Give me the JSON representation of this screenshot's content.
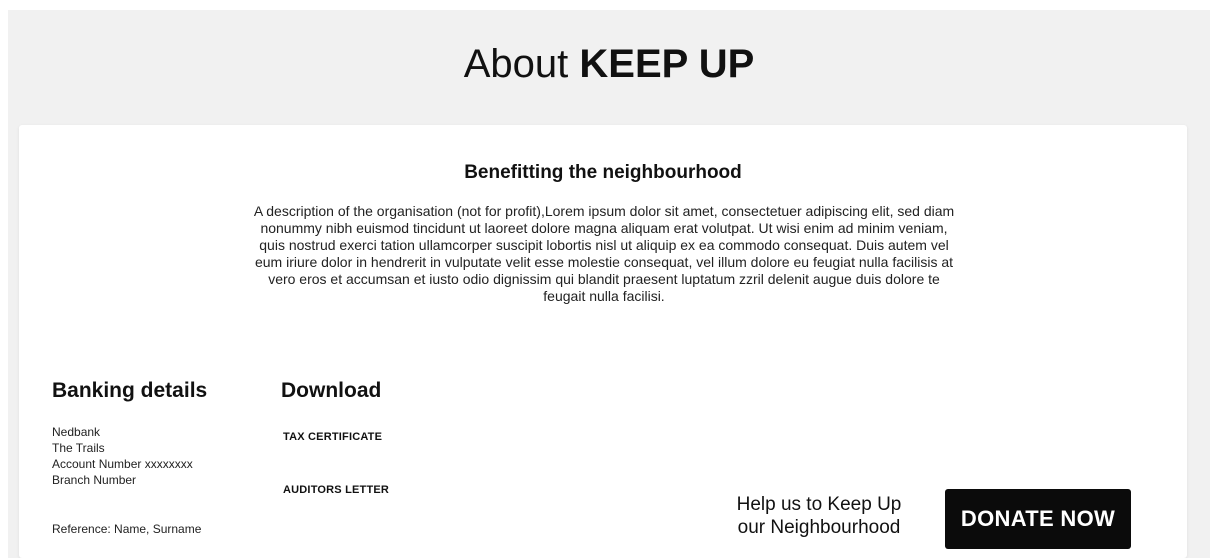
{
  "header": {
    "title_prefix": "About ",
    "title_brand": "KEEP UP"
  },
  "intro": {
    "heading": "Benefitting the neighbourhood",
    "description": "A description of the organisation (not for profit),Lorem ipsum dolor sit amet, consectetuer adipiscing elit, sed diam nonummy nibh euismod tincidunt ut laoreet dolore magna aliquam erat volutpat. Ut wisi enim ad minim veniam, quis nostrud exerci tation ullamcorper suscipit lobortis nisl ut aliquip ex ea commodo consequat. Duis autem vel eum iriure dolor in hendrerit in vulputate velit esse molestie consequat, vel illum dolore eu feugiat nulla facilisis at vero eros et accumsan et iusto odio dignissim qui blandit praesent luptatum zzril delenit augue duis dolore te feugait nulla facilisi."
  },
  "banking": {
    "title": "Banking details",
    "lines": [
      "Nedbank",
      "The Trails",
      "Account Number xxxxxxxx",
      "Branch Number"
    ],
    "reference": "Reference: Name, Surname"
  },
  "download": {
    "title": "Download",
    "links": [
      "TAX CERTIFICATE",
      "AUDITORS LETTER"
    ]
  },
  "cta": {
    "help_line1": "Help us to Keep Up",
    "help_line2": "our Neighbourhood",
    "donate_label": "DONATE NOW"
  }
}
